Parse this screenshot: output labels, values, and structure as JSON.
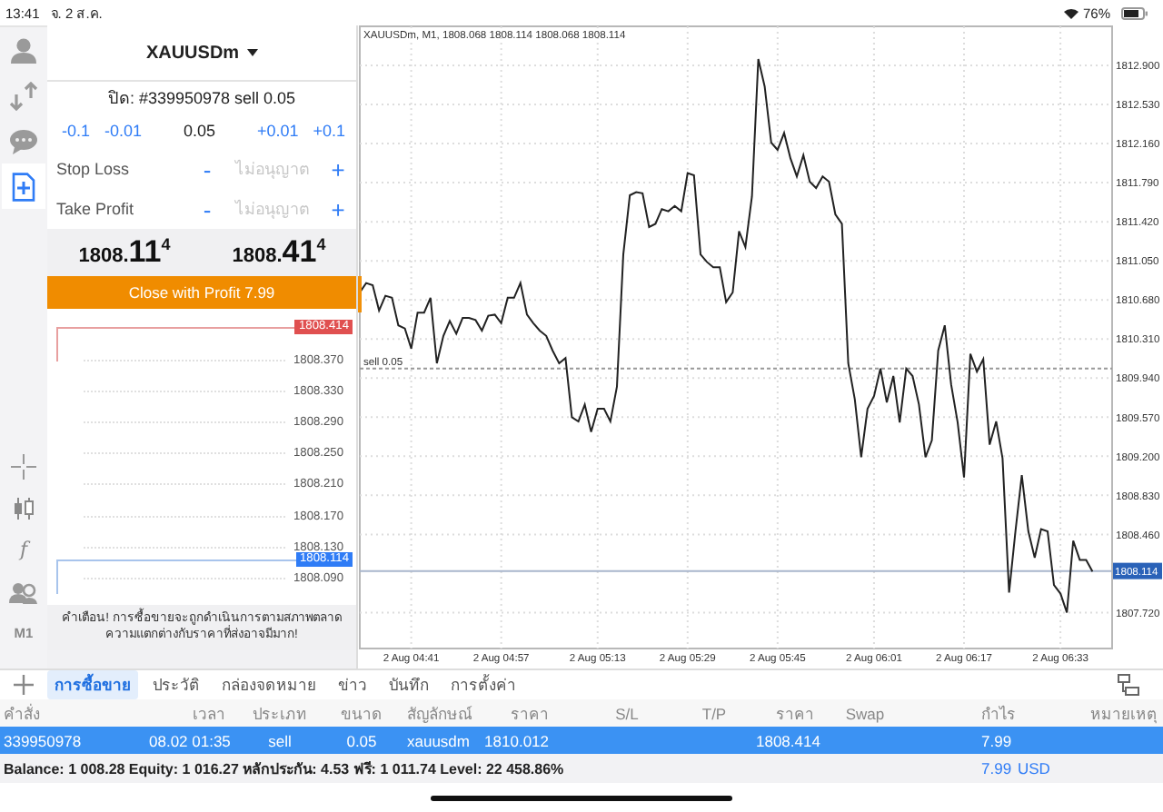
{
  "status_bar": {
    "time": "13:41",
    "date": "จ. 2 ส.ค.",
    "battery": "76%"
  },
  "sidebar": {
    "items": [
      {
        "selected": false
      },
      {
        "selected": false
      },
      {
        "selected": false
      },
      {
        "selected": true
      }
    ],
    "function_tool": "f",
    "period": "M1"
  },
  "order_panel": {
    "symbol": "XAUUSDm",
    "close_info": "ปิด: #339950978 sell 0.05",
    "volume_down": [
      "-0.1",
      "-0.01"
    ],
    "volume": "0.05",
    "volume_up": [
      "+0.01",
      "+0.1"
    ],
    "stops": [
      {
        "label": "Stop Loss",
        "minus": "-",
        "placeholder": "ไม่อนุญาต",
        "plus": "+"
      },
      {
        "label": "Take Profit",
        "minus": "-",
        "placeholder": "ไม่อนุญาต",
        "plus": "+"
      }
    ],
    "prices": [
      {
        "head": "1808.",
        "big": "11",
        "pip": "4"
      },
      {
        "head": "1808.",
        "big": "41",
        "pip": "4"
      }
    ],
    "close_button": "Close with Profit 7.99",
    "mini_chart": {
      "ask": "1808.414",
      "bid": "1808.114",
      "ticks": [
        "1808.370",
        "1808.330",
        "1808.290",
        "1808.250",
        "1808.210",
        "1808.170",
        "1808.130",
        "1808.090"
      ]
    },
    "warning": "คำเตือน! การซื้อขายจะถูกดำเนินการตามสภาพตลาด ความแตกต่างกับราคาที่ส่งอาจมีมาก!"
  },
  "chart": {
    "title": "XAUUSDm, M1, 1808.068 1808.114 1808.068 1808.114",
    "chart_data": {
      "type": "line",
      "categories": [
        null,
        null,
        null,
        null,
        null,
        null,
        null,
        null,
        "2 Aug 04:41",
        null,
        null,
        null,
        null,
        null,
        null,
        null,
        null,
        null,
        null,
        null,
        null,
        null,
        "2 Aug 04:57",
        null,
        null,
        null,
        null,
        null,
        null,
        null,
        null,
        null,
        null,
        null,
        null,
        null,
        null,
        "2 Aug 05:13",
        null,
        null,
        null,
        null,
        null,
        null,
        null,
        null,
        null,
        null,
        null,
        null,
        null,
        "2 Aug 05:29",
        null,
        null,
        null,
        null,
        null,
        null,
        null,
        null,
        null,
        null,
        null,
        null,
        null,
        "2 Aug 05:45",
        null,
        null,
        null,
        null,
        null,
        null,
        null,
        null,
        null,
        null,
        null,
        null,
        null,
        null,
        "2 Aug 06:01",
        null,
        null,
        null,
        null,
        null,
        null,
        null,
        null,
        null,
        null,
        null,
        null,
        null,
        "2 Aug 06:17",
        null,
        null,
        null,
        null,
        null,
        null,
        null,
        null,
        null,
        null,
        null,
        null,
        null,
        null,
        "2 Aug 06:33",
        null,
        null,
        null,
        null,
        null
      ],
      "series": [
        {
          "color": "#222222",
          "values": [
            1810.75,
            1810.84,
            1810.82,
            1810.58,
            1810.72,
            1810.7,
            1810.44,
            1810.41,
            1810.22,
            1810.56,
            1810.56,
            1810.7,
            1810.08,
            1810.34,
            1810.48,
            1810.36,
            1810.51,
            1810.51,
            1810.49,
            1810.39,
            1810.53,
            1810.54,
            1810.46,
            1810.7,
            1810.7,
            1810.84,
            1810.54,
            1810.46,
            1810.39,
            1810.34,
            1810.2,
            1810.08,
            1810.13,
            1809.57,
            1809.53,
            1809.69,
            1809.43,
            1809.65,
            1809.65,
            1809.53,
            1809.86,
            1811.11,
            1811.67,
            1811.7,
            1811.69,
            1811.37,
            1811.4,
            1811.54,
            1811.52,
            1811.57,
            1811.52,
            1811.88,
            1811.86,
            1811.11,
            1811.04,
            1810.99,
            1810.99,
            1810.66,
            1810.75,
            1811.33,
            1811.18,
            1811.66,
            1812.96,
            1812.7,
            1812.17,
            1812.1,
            1812.26,
            1812.02,
            1811.85,
            1812.05,
            1811.8,
            1811.74,
            1811.85,
            1811.8,
            1811.49,
            1811.4,
            1810.08,
            1809.74,
            1809.19,
            1809.65,
            1809.77,
            1810.03,
            1809.71,
            1809.96,
            1809.52,
            1810.03,
            1809.96,
            1809.69,
            1809.19,
            1809.35,
            1810.2,
            1810.44,
            1809.88,
            1809.52,
            1809.0,
            1810.17,
            1810.0,
            1810.12,
            1809.31,
            1809.53,
            1809.18,
            1807.91,
            1808.49,
            1809.02,
            1808.49,
            1808.24,
            1808.51,
            1808.49,
            1807.98,
            1807.9,
            1807.72,
            1808.4,
            1808.22,
            1808.22,
            1808.11
          ]
        }
      ],
      "ylim": [
        1807.38,
        1813.27
      ],
      "grid": true,
      "yticks": [
        {
          "value": 1812.9,
          "label": "1812.900"
        },
        {
          "value": 1812.53,
          "label": "1812.530"
        },
        {
          "value": 1812.16,
          "label": "1812.160"
        },
        {
          "value": 1811.79,
          "label": "1811.790"
        },
        {
          "value": 1811.42,
          "label": "1811.420"
        },
        {
          "value": 1811.05,
          "label": "1811.050"
        },
        {
          "value": 1810.68,
          "label": "1810.680"
        },
        {
          "value": 1810.31,
          "label": "1810.310"
        },
        {
          "value": 1809.94,
          "label": "1809.940"
        },
        {
          "value": 1809.57,
          "label": "1809.570"
        },
        {
          "value": 1809.2,
          "label": "1809.200"
        },
        {
          "value": 1808.83,
          "label": "1808.830"
        },
        {
          "value": 1808.46,
          "label": "1808.460"
        },
        {
          "value": 1807.72,
          "label": "1807.720"
        }
      ],
      "ref_lines": [
        {
          "axis": "y",
          "value": 1810.03,
          "label": "sell 0.05"
        },
        {
          "axis": "y",
          "value": 1808.114,
          "label": "1808.114"
        }
      ]
    }
  },
  "terminal": {
    "tabs": [
      {
        "label": "การซื้อขาย",
        "selected": true
      },
      {
        "label": "ประวัติ",
        "selected": false
      },
      {
        "label": "กล่องจดหมาย",
        "selected": false
      },
      {
        "label": "ข่าว",
        "selected": false
      },
      {
        "label": "บันทึก",
        "selected": false
      },
      {
        "label": "การตั้งค่า",
        "selected": false
      }
    ],
    "columns": [
      "คำสั่ง",
      "เวลา",
      "ประเภท",
      "ขนาด",
      "สัญลักษณ์",
      "ราคา",
      "S/L",
      "T/P",
      "ราคา",
      "Swap",
      "กำไร",
      "หมายเหตุ"
    ],
    "rows": [
      {
        "selected": true,
        "cells": [
          "339950978",
          "08.02 01:35",
          "sell",
          "0.05",
          "xauusdm",
          "1810.012",
          null,
          null,
          "1808.414",
          null,
          "7.99",
          null
        ]
      }
    ],
    "balance": "Balance: 1 008.28 Equity: 1 016.27 หลักประกัน: 4.53 ฟรี: 1 011.74 Level: 22 458.86%",
    "profit": "7.99",
    "currency": "USD"
  }
}
